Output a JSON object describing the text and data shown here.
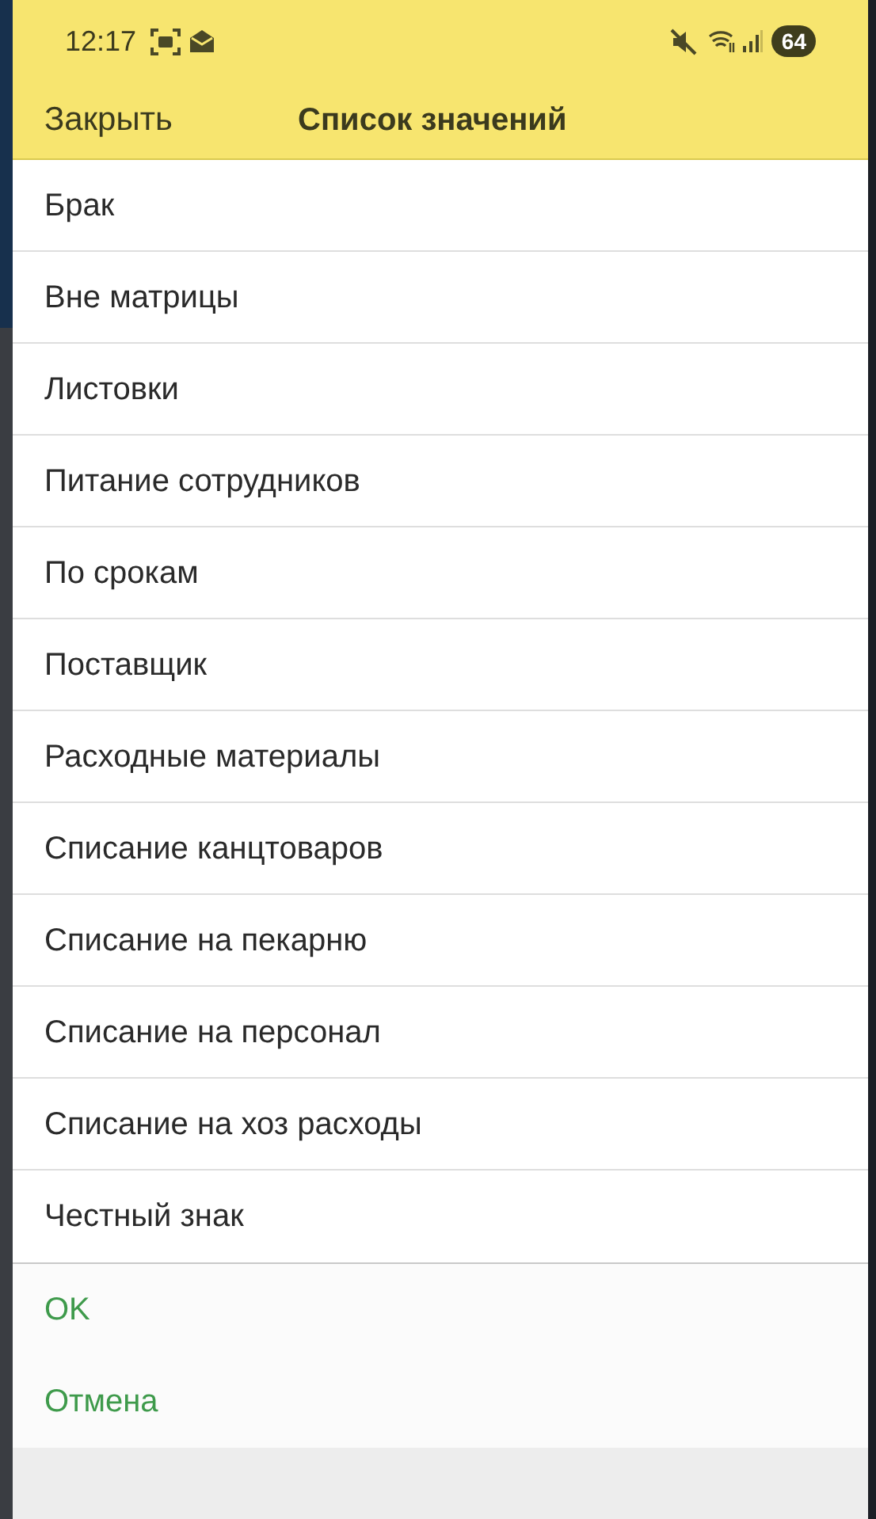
{
  "status_bar": {
    "time": "12:17",
    "battery": "64"
  },
  "header": {
    "close": "Закрыть",
    "title": "Список значений"
  },
  "items": [
    {
      "label": "Брак"
    },
    {
      "label": "Вне матрицы"
    },
    {
      "label": "Листовки"
    },
    {
      "label": "Питание сотрудников"
    },
    {
      "label": "По срокам"
    },
    {
      "label": "Поставщик"
    },
    {
      "label": "Расходные материалы"
    },
    {
      "label": "Списание канцтоваров"
    },
    {
      "label": "Списание на пекарню"
    },
    {
      "label": "Списание на персонал"
    },
    {
      "label": "Списание на хоз расходы"
    },
    {
      "label": "Честный знак"
    }
  ],
  "actions": [
    {
      "label": "OK"
    },
    {
      "label": "Отмена"
    }
  ]
}
